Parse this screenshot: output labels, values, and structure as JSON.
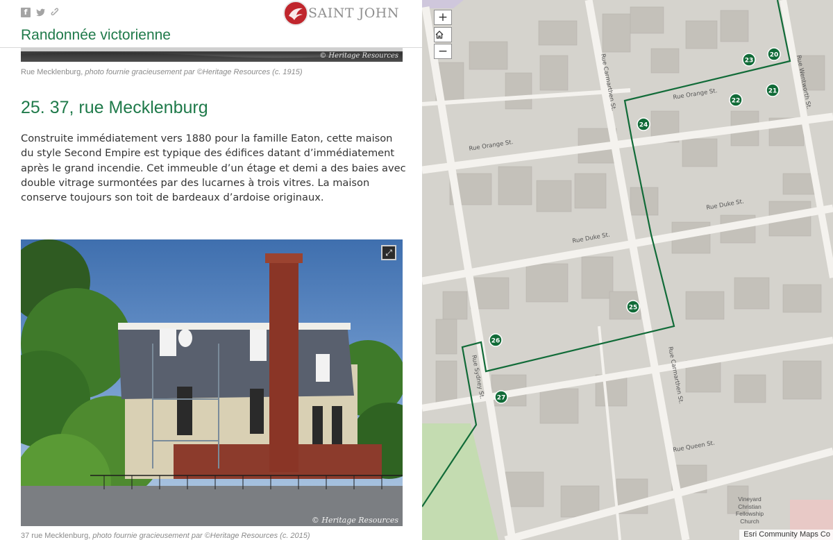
{
  "header": {
    "title": "Randonnée victorienne",
    "logo_text": "SAINT JOHN",
    "share_icons": [
      "facebook-icon",
      "twitter-icon",
      "link-icon"
    ]
  },
  "top_image": {
    "credit": "© Heritage Resources",
    "caption_main": "Rue Mecklenburg,",
    "caption_credit": "photo fournie gracieusement par ©Heritage Resources (c. 1915)"
  },
  "section": {
    "title": "25. 37, rue Mecklenburg",
    "description": "Construite immédiatement vers 1880 pour la famille Eaton, cette maison du style Second Empire est typique des édifices datant d’immédiatement après le grand incendie. Cet immeuble d’un étage et demi a des baies avec double vitrage surmontées par des lucarnes à trois vitres. La maison conserve toujours son toit de bardeaux d’ardoise originaux."
  },
  "photo": {
    "credit": "© Heritage Resources",
    "caption_main": "37 rue Mecklenburg,",
    "caption_credit": "photo fournie gracieusement par ©Heritage Resources (c. 2015)",
    "expand_icon": "expand-icon"
  },
  "map": {
    "zoom_in": "+",
    "zoom_out": "−",
    "home_icon": "home-icon",
    "attribution": "Esri Community Maps Co",
    "streets": {
      "orange_1": "Rue Orange St.",
      "orange_2": "Rue Orange St.",
      "duke_1": "Rue Duke St.",
      "duke_2": "Rue Duke St.",
      "queen": "Rue Queen St.",
      "carmarthen_1": "Rue Carmarthen St.",
      "carmarthen_2": "Rue Carmarthen St.",
      "wentworth": "Rue Wentworth St.",
      "sydney": "Rue Sydney St."
    },
    "church": [
      "Vineyard",
      "Christian",
      "Fellowship",
      "Church"
    ],
    "stops": [
      "20",
      "21",
      "22",
      "23",
      "24",
      "25",
      "26",
      "27"
    ],
    "route_color": "#116b38"
  }
}
